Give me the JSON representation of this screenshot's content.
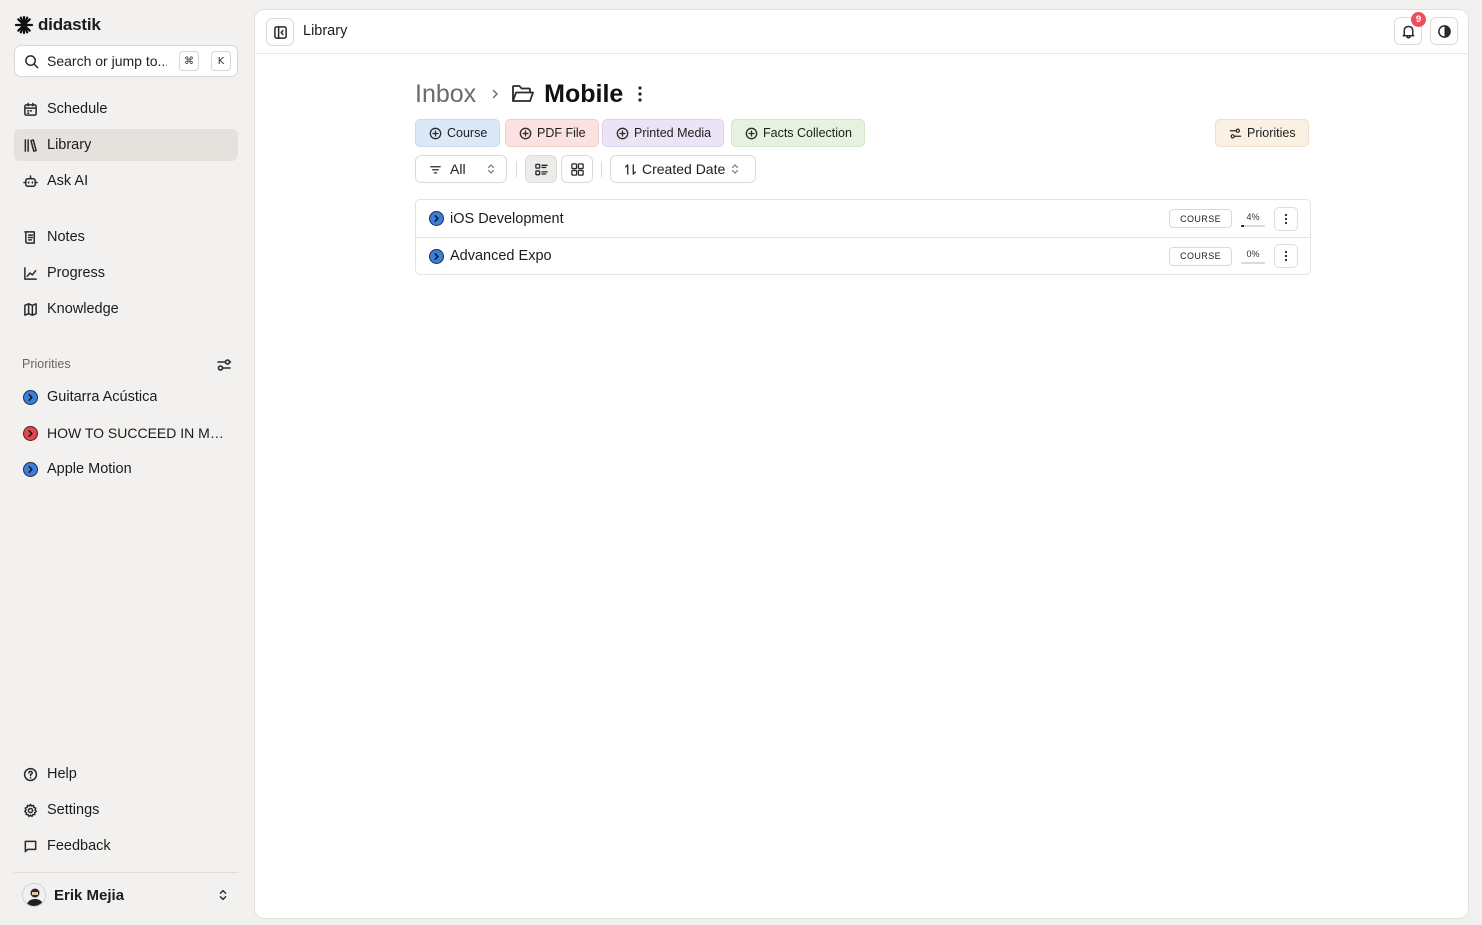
{
  "app": {
    "name": "didastik"
  },
  "search": {
    "placeholder": "Search or jump to...",
    "display": "Search or jump to...",
    "shortcut_mod": "⌘",
    "shortcut_key": "K"
  },
  "nav": {
    "primary": [
      {
        "id": "schedule",
        "label": "Schedule",
        "icon": "calendar-icon",
        "active": false
      },
      {
        "id": "library",
        "label": "Library",
        "icon": "library-icon",
        "active": true
      },
      {
        "id": "ask-ai",
        "label": "Ask AI",
        "icon": "bot-icon",
        "active": false
      }
    ],
    "secondary": [
      {
        "id": "notes",
        "label": "Notes",
        "icon": "notes-icon"
      },
      {
        "id": "progress",
        "label": "Progress",
        "icon": "chart-icon"
      },
      {
        "id": "knowledge",
        "label": "Knowledge",
        "icon": "map-icon"
      }
    ]
  },
  "priorities": {
    "label": "Priorities",
    "items": [
      {
        "label": "Guitarra Acústica",
        "color": "#3b7fd9"
      },
      {
        "label": "HOW TO SUCCEED IN MRBE...",
        "color": "#e0484f"
      },
      {
        "label": "Apple Motion",
        "color": "#3b7fd9"
      }
    ]
  },
  "footer_nav": [
    {
      "id": "help",
      "label": "Help",
      "icon": "help-circle-icon"
    },
    {
      "id": "settings",
      "label": "Settings",
      "icon": "gear-icon"
    },
    {
      "id": "feedback",
      "label": "Feedback",
      "icon": "message-icon"
    }
  ],
  "user": {
    "name": "Erik Mejia"
  },
  "topbar": {
    "title": "Library",
    "notification_count": "9"
  },
  "breadcrumb": {
    "parent": "Inbox",
    "current": "Mobile"
  },
  "add_chips": {
    "course": "Course",
    "pdf": "PDF File",
    "printed": "Printed Media",
    "facts": "Facts Collection"
  },
  "priorities_button": "Priorities",
  "filter": {
    "value": "All"
  },
  "sort": {
    "value": "Created Date"
  },
  "items": [
    {
      "title": "iOS Development",
      "type": "COURSE",
      "progress_label": "4%",
      "progress": 0.04
    },
    {
      "title": "Advanced Expo",
      "type": "COURSE",
      "progress_label": "0%",
      "progress": 0.0
    }
  ],
  "colors": {
    "accent_blue": "#3b7fd9",
    "accent_red": "#e0484f",
    "badge_red": "#ef4d5a"
  }
}
